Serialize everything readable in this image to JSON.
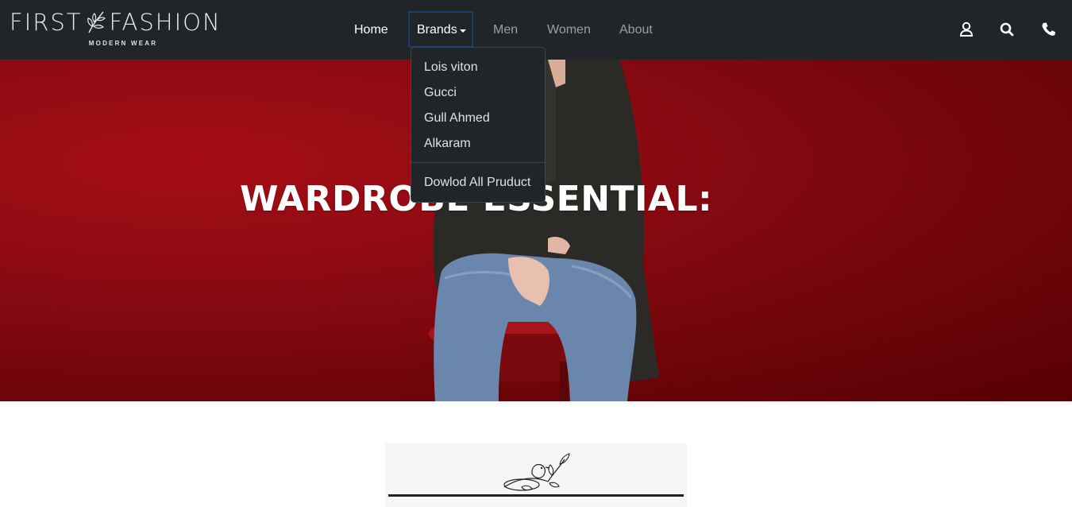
{
  "brand": {
    "name_left": "FIRST",
    "name_right": "FASHION",
    "tagline": "MODERN WEAR"
  },
  "nav": {
    "home": "Home",
    "brands": "Brands",
    "men": "Men",
    "women": "Women",
    "about": "About"
  },
  "icons": {
    "account": "user-icon",
    "search": "search-icon",
    "phone": "phone-icon"
  },
  "dropdown": {
    "items": [
      "Lois viton",
      "Gucci",
      "Gull Ahmed",
      "Alkaram"
    ],
    "download": "Dowlod All Pruduct"
  },
  "hero": {
    "title": "WARDROBE ESSENTIAL:"
  },
  "colors": {
    "navbar": "#212529",
    "hero_red": "#8c0a12",
    "active_outline": "#1c3d6e"
  }
}
